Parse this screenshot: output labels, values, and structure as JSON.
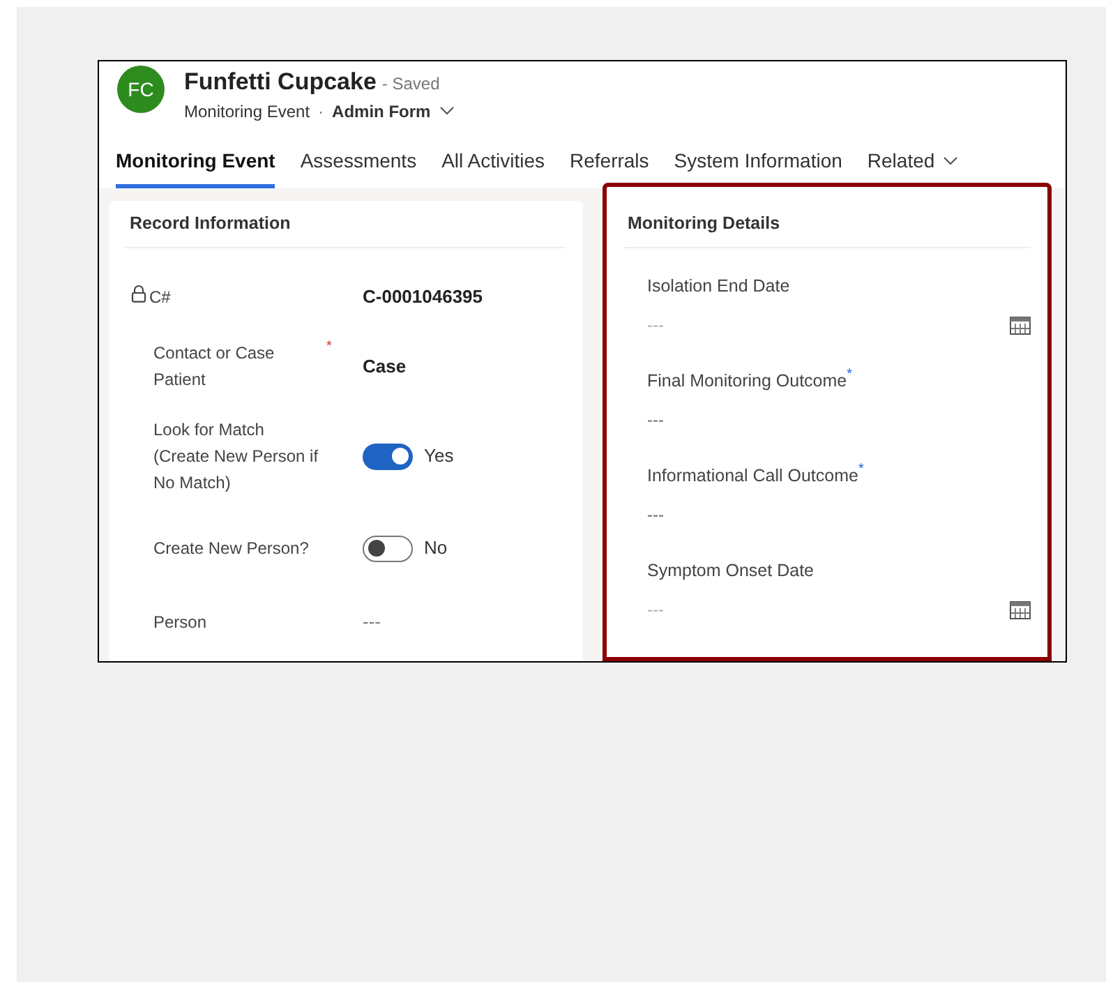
{
  "record": {
    "avatar": "FC",
    "title": "Funfetti Cupcake",
    "status": "- Saved",
    "entity": "Monitoring Event",
    "separator": "·",
    "form": "Admin Form"
  },
  "tabs": [
    {
      "label": "Monitoring Event",
      "selected": true,
      "dropdown": false
    },
    {
      "label": "Assessments",
      "selected": false,
      "dropdown": false
    },
    {
      "label": "All Activities",
      "selected": false,
      "dropdown": false
    },
    {
      "label": "Referrals",
      "selected": false,
      "dropdown": false
    },
    {
      "label": "System Information",
      "selected": false,
      "dropdown": false
    },
    {
      "label": "Related",
      "selected": false,
      "dropdown": true
    }
  ],
  "left_section": {
    "title": "Record Information",
    "highlighted": false,
    "fields": [
      {
        "label": "C#",
        "kind": "text",
        "locked": true,
        "value": "C-0001046395"
      },
      {
        "label": "Contact or Case Patient",
        "kind": "text",
        "locked": false,
        "required_mark": {
          "text": "*",
          "color": "#d13438"
        },
        "value": "Case"
      },
      {
        "label": "Look for Match (Create New Person if No Match)",
        "kind": "toggle",
        "on": true,
        "locked": false,
        "value": "Yes"
      },
      {
        "label": "Create New Person?",
        "kind": "toggle",
        "on": false,
        "locked": false,
        "value": "No"
      },
      {
        "label": "Person",
        "kind": "empty",
        "locked": false,
        "value": "---"
      }
    ]
  },
  "right_section": {
    "title": "Monitoring Details",
    "highlighted": true,
    "fields": [
      {
        "label": "Isolation End Date",
        "kind": "date",
        "placeholder": "---"
      },
      {
        "label": "Final Monitoring Outcome",
        "kind": "empty",
        "required_mark": {
          "text": "*",
          "color": "#2266e3"
        },
        "value": "---"
      },
      {
        "label": "Informational Call Outcome",
        "kind": "empty",
        "required_mark": {
          "text": "*",
          "color": "#2266e3"
        },
        "value": "---"
      },
      {
        "label": "Symptom Onset Date",
        "kind": "date",
        "placeholder": "---"
      }
    ]
  }
}
